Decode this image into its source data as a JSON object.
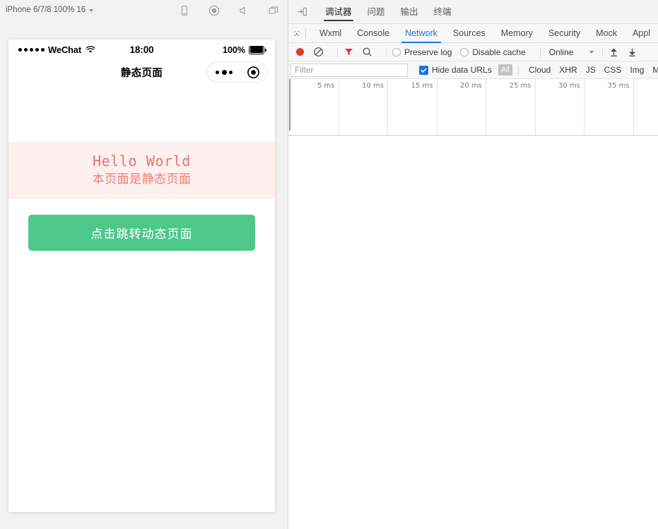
{
  "simulator": {
    "device_label": "iPhone 6/7/8 100% 16",
    "toolbar_icons": [
      "device-rotate-icon",
      "record-icon",
      "volume-icon",
      "multi-window-icon"
    ],
    "status_bar": {
      "carrier": "WeChat",
      "signal_dots": 5,
      "time": "18:00",
      "battery_percent": "100%"
    },
    "nav_bar": {
      "title": "静态页面",
      "capsule_icons": [
        "more-dots-icon",
        "target-circle-icon"
      ]
    },
    "page": {
      "hello_en": "Hello World",
      "hello_cn": "本页面是静态页面",
      "hello_color": "#e8736c",
      "hello_bg": "#fdf0ef",
      "jump_button_label": "点击跳转动态页面",
      "jump_button_color": "#4ec78b"
    }
  },
  "devtools": {
    "panel_toggle_icon": "panel-expand-icon",
    "top_tabs": [
      {
        "label": "调试器",
        "active": true
      },
      {
        "label": "问题",
        "active": false
      },
      {
        "label": "输出",
        "active": false
      },
      {
        "label": "终端",
        "active": false
      }
    ],
    "inspect_icon": "inspect-cursor-icon",
    "sub_tabs": [
      {
        "label": "Wxml",
        "active": false
      },
      {
        "label": "Console",
        "active": false
      },
      {
        "label": "Network",
        "active": true
      },
      {
        "label": "Sources",
        "active": false
      },
      {
        "label": "Memory",
        "active": false
      },
      {
        "label": "Security",
        "active": false
      },
      {
        "label": "Mock",
        "active": false
      },
      {
        "label": "Appl",
        "active": false
      }
    ],
    "network_toolbar": {
      "record_icon": "record-red-dot-icon",
      "clear_icon": "clear-no-entry-icon",
      "filter_icon": "filter-funnel-icon",
      "search_icon": "search-magnifier-icon",
      "preserve_log_label": "Preserve log",
      "preserve_log_checked": false,
      "disable_cache_label": "Disable cache",
      "disable_cache_checked": false,
      "throttling_value": "Online",
      "import_icon": "upload-arrow-icon",
      "export_icon": "download-arrow-icon"
    },
    "filter_bar": {
      "filter_placeholder": "Filter",
      "filter_value": "",
      "hide_data_urls_label": "Hide data URLs",
      "hide_data_urls_checked": true,
      "all_pill": "All",
      "type_filters": [
        "Cloud",
        "XHR",
        "JS",
        "CSS",
        "Img",
        "Media"
      ]
    },
    "timeline": {
      "tick_labels": [
        "5 ms",
        "10 ms",
        "15 ms",
        "20 ms",
        "25 ms",
        "30 ms",
        "35 ms"
      ],
      "tick_interval_ms": 5,
      "tick_spacing_px": 69.5
    }
  },
  "accent": {
    "blue": "#1a73e8",
    "red": "#e53935",
    "green": "#4ec78b"
  }
}
